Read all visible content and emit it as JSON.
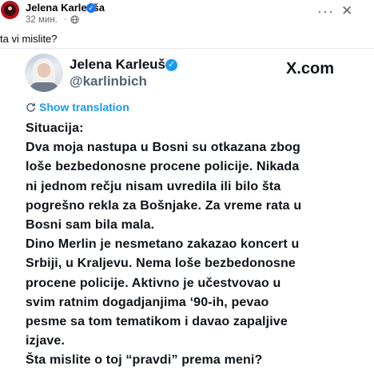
{
  "facebook_post": {
    "author": "Jelena Karleuša",
    "time": "32 мин.",
    "dot": "·",
    "caption": "ta vi mislite?",
    "more_label": "···",
    "close_label": "✕",
    "icons": {
      "verified": "verified-badge-icon",
      "audience": "globe-icon"
    }
  },
  "tweet": {
    "display_name": "Jelena Karleuša",
    "handle": "@karlinbich",
    "site": "X.com",
    "translate_label": "Show translation",
    "lines": [
      "Situacija:",
      "Dva moja nastupa u Bosni su otkazana zbog",
      "loše bezbedonosne procene policije. Nikada",
      "ni jednom rečju nisam uvredila ili bilo šta",
      "pogrešno rekla za Bošnjake. Za vreme rata u",
      "Bosni sam bila mala.",
      "Dino Merlin je nesmetano zakazao koncert u",
      "Srbiji, u Kraljevu. Nema loše bezbedonosne",
      "procene policije. Aktivno je učestvovao u",
      "svim ratnim dogadjanjima ‘90-ih, pevao",
      "pesme sa tom tematikom i davao zapaljive",
      "izjave.",
      "Šta mislite o toj “pravdi” prema meni?"
    ]
  },
  "colors": {
    "facebook_blue": "#1877f2",
    "twitter_blue": "#1d9bf0",
    "text_dark": "#0f1419",
    "text_muted": "#65676b"
  }
}
